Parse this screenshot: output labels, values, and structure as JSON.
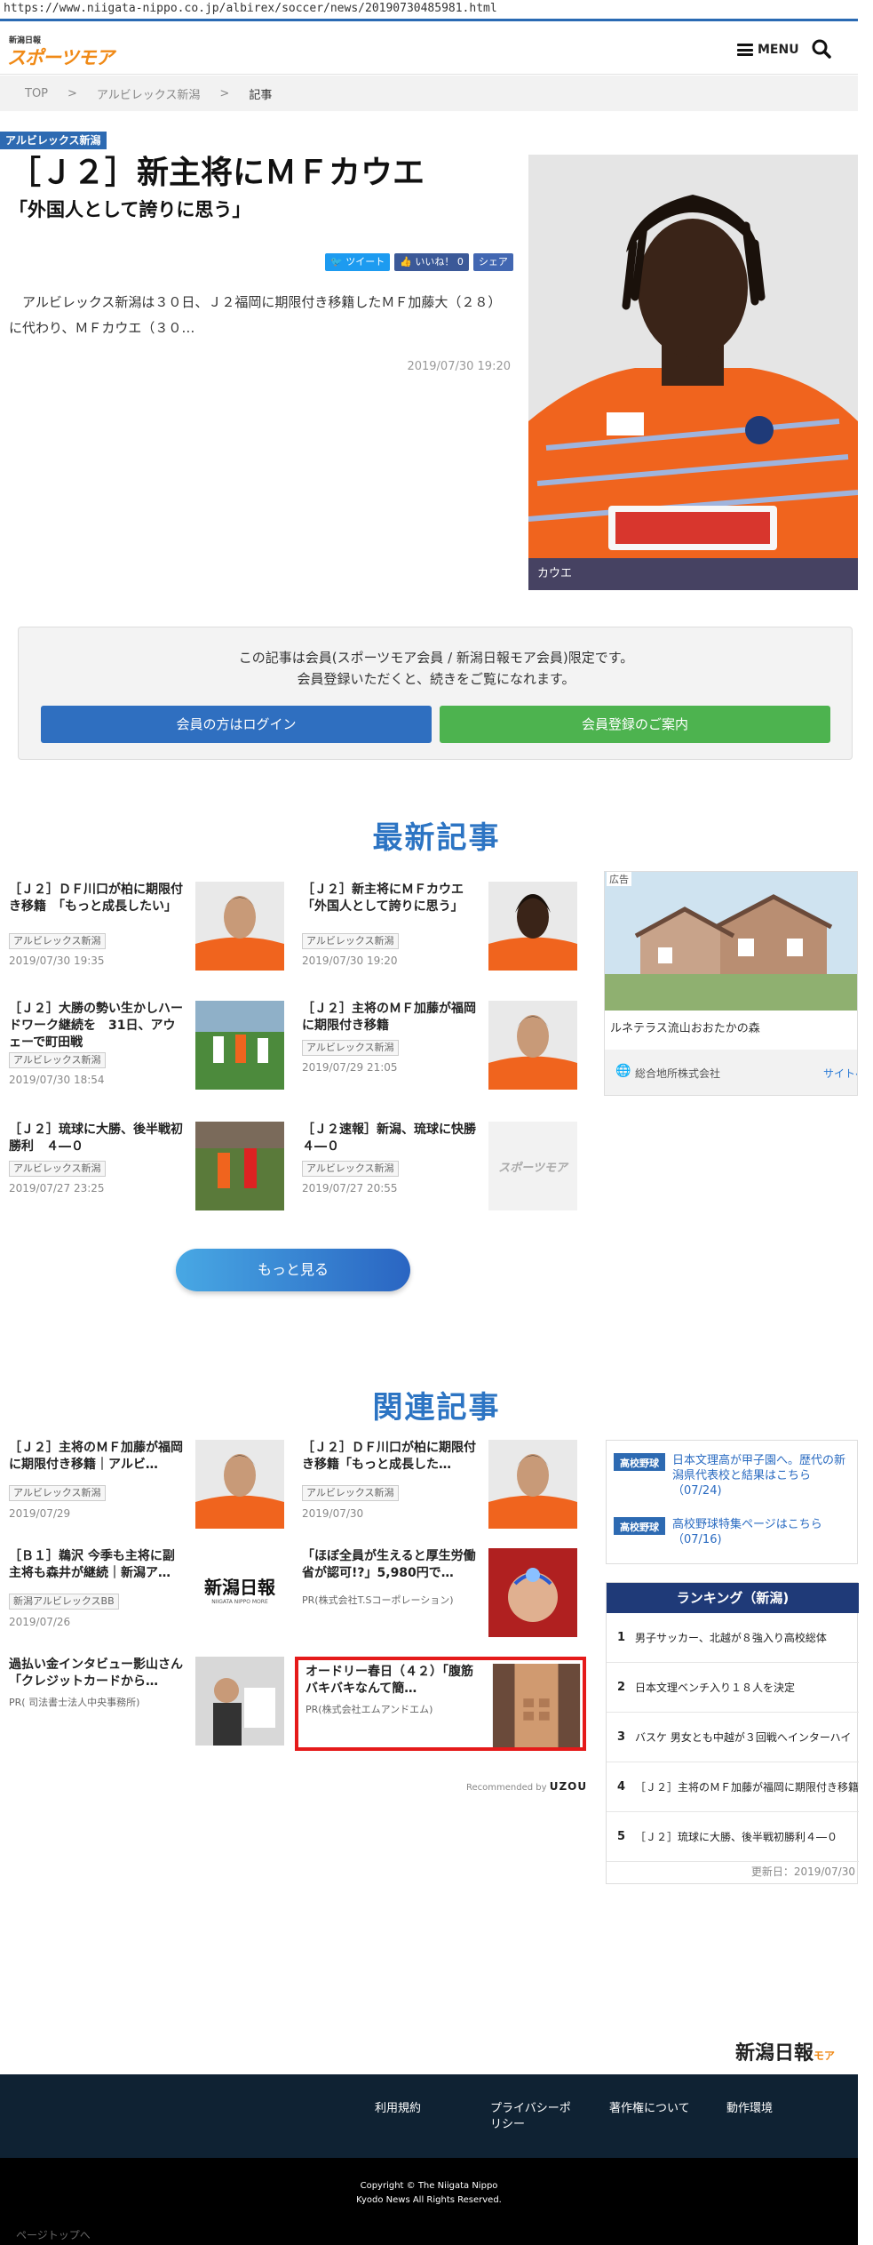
{
  "url": "https://www.niigata-nippo.co.jp/albirex/soccer/news/20190730485981.html",
  "header": {
    "logo_top": "新潟日報",
    "logo_main": "スポーツモア",
    "menu_label": "MENU"
  },
  "breadcrumb": [
    "TOP",
    ">",
    "アルビレックス新潟",
    ">",
    "記事"
  ],
  "article": {
    "category": "アルビレックス新潟",
    "title": "［Ｊ２］新主将にＭＦカウエ",
    "subtitle": "「外国人として誇りに思う」",
    "share": {
      "tweet": "ツイート",
      "like": "いいね！ 0",
      "share": "シェア"
    },
    "lead": "　アルビレックス新潟は３０日、Ｊ２福岡に期限付き移籍したＭＦ加藤大（２８）に代わり、ＭＦカウエ（３０…",
    "date": "2019/07/30 19:20",
    "photo_caption": "カウエ"
  },
  "paywall": {
    "line1": "この記事は会員(スポーツモア会員 / 新潟日報モア会員)限定です。",
    "line2": "会員登録いただくと、続きをご覧になれます。",
    "login_label": "会員の方はログイン",
    "register_label": "会員登録のご案内"
  },
  "latest": {
    "heading": "最新記事",
    "items": [
      {
        "title": "［Ｊ２］ＤＦ川口が柏に期限付き移籍　「もっと成長したい」",
        "tag": "アルビレックス新潟",
        "date": "2019/07/30 19:35"
      },
      {
        "title": "［Ｊ２］新主将にＭＦカウエ　「外国人として誇りに思う」",
        "tag": "アルビレックス新潟",
        "date": "2019/07/30 19:20"
      },
      {
        "title": "［Ｊ２］大勝の勢い生かしハードワーク継続を　31日、アウェーで町田戦",
        "tag": "アルビレックス新潟",
        "date": "2019/07/30 18:54"
      },
      {
        "title": "［Ｊ２］主将のＭＦ加藤が福岡に期限付き移籍",
        "tag": "アルビレックス新潟",
        "date": "2019/07/29 21:05"
      },
      {
        "title": "［Ｊ２］琉球に大勝、後半戦初勝利　４―０",
        "tag": "アルビレックス新潟",
        "date": "2019/07/27 23:25"
      },
      {
        "title": "［Ｊ２速報］新潟、琉球に快勝　４―０",
        "tag": "アルビレックス新潟",
        "date": "2019/07/27 20:55"
      }
    ],
    "more_label": "もっと見る",
    "placeholder_logo": "スポーツモア"
  },
  "ad": {
    "label": "広告",
    "title": "ルネテラス流山おおたかの森",
    "company": "総合地所株式会社",
    "site": "サイトへ"
  },
  "related": {
    "heading": "関連記事",
    "items": [
      {
        "title": "［Ｊ２］主将のＭＦ加藤が福岡に期限付き移籍｜アルビ…",
        "tag": "アルビレックス新潟",
        "date": "2019/07/29"
      },
      {
        "title": "［Ｊ２］ＤＦ川口が柏に期限付き移籍「もっと成長した…",
        "tag": "アルビレックス新潟",
        "date": "2019/07/30"
      },
      {
        "title": "［Ｂ１］鵜沢 今季も主将に副主将も森井が継続｜新潟ア…",
        "tag": "新潟アルビレックスBB",
        "date": "2019/07/26"
      },
      {
        "title": "「ほぼ全員が生えると厚生労働省が認可!?」5,980円で…",
        "tag": "PR(株式会社T.Sコーポレーション)",
        "date": ""
      },
      {
        "title": "過払い金インタビュー影山さん「クレジットカードから…",
        "tag": "PR( 司法書士法人中央事務所)",
        "date": ""
      },
      {
        "title": "オードリー春日（４２）「腹筋バキバキなんて簡…",
        "tag": "PR(株式会社エムアンドエム)",
        "date": ""
      }
    ],
    "niigata_logo": "新潟日報",
    "niigata_logo_sub": "NIIGATA NIPPO MORE",
    "recommended_prefix": "Recommended by",
    "recommended_brand": "UZOU"
  },
  "highschool": [
    {
      "tag": "高校野球",
      "text": "日本文理高が甲子園へ。歴代の新潟県代表校と結果はこちら（07/24)"
    },
    {
      "tag": "高校野球",
      "text": "高校野球特集ページはこちら（07/16)"
    }
  ],
  "ranking": {
    "heading": "ランキング（新潟)",
    "items": [
      {
        "rank": "1",
        "text": "男子サッカー、北越が８強入り高校総体"
      },
      {
        "rank": "2",
        "text": "日本文理ベンチ入り１８人を決定"
      },
      {
        "rank": "3",
        "text": "バスケ 男女とも中越が３回戦へインターハイ"
      },
      {
        "rank": "4",
        "text": "［Ｊ２］主将のＭＦ加藤が福岡に期限付き移籍"
      },
      {
        "rank": "5",
        "text": "［Ｊ２］琉球に大勝、後半戦初勝利４―０"
      }
    ],
    "updated": "更新日：2019/07/30"
  },
  "footer": {
    "logo": "新潟日報",
    "logo_sub": "モア",
    "links": [
      "利用規約",
      "プライバシーポリシー",
      "著作権について",
      "動作環境"
    ],
    "copy1": "Copyright © The Niigata Nippo",
    "copy2": "Kyodo News All Rights Reserved.",
    "pagetop": "ページトップへ"
  },
  "colors": {
    "accent": "#2c74c3",
    "login": "#2f6fc0",
    "register": "#4db34f",
    "highlight": "#e51a1a"
  }
}
